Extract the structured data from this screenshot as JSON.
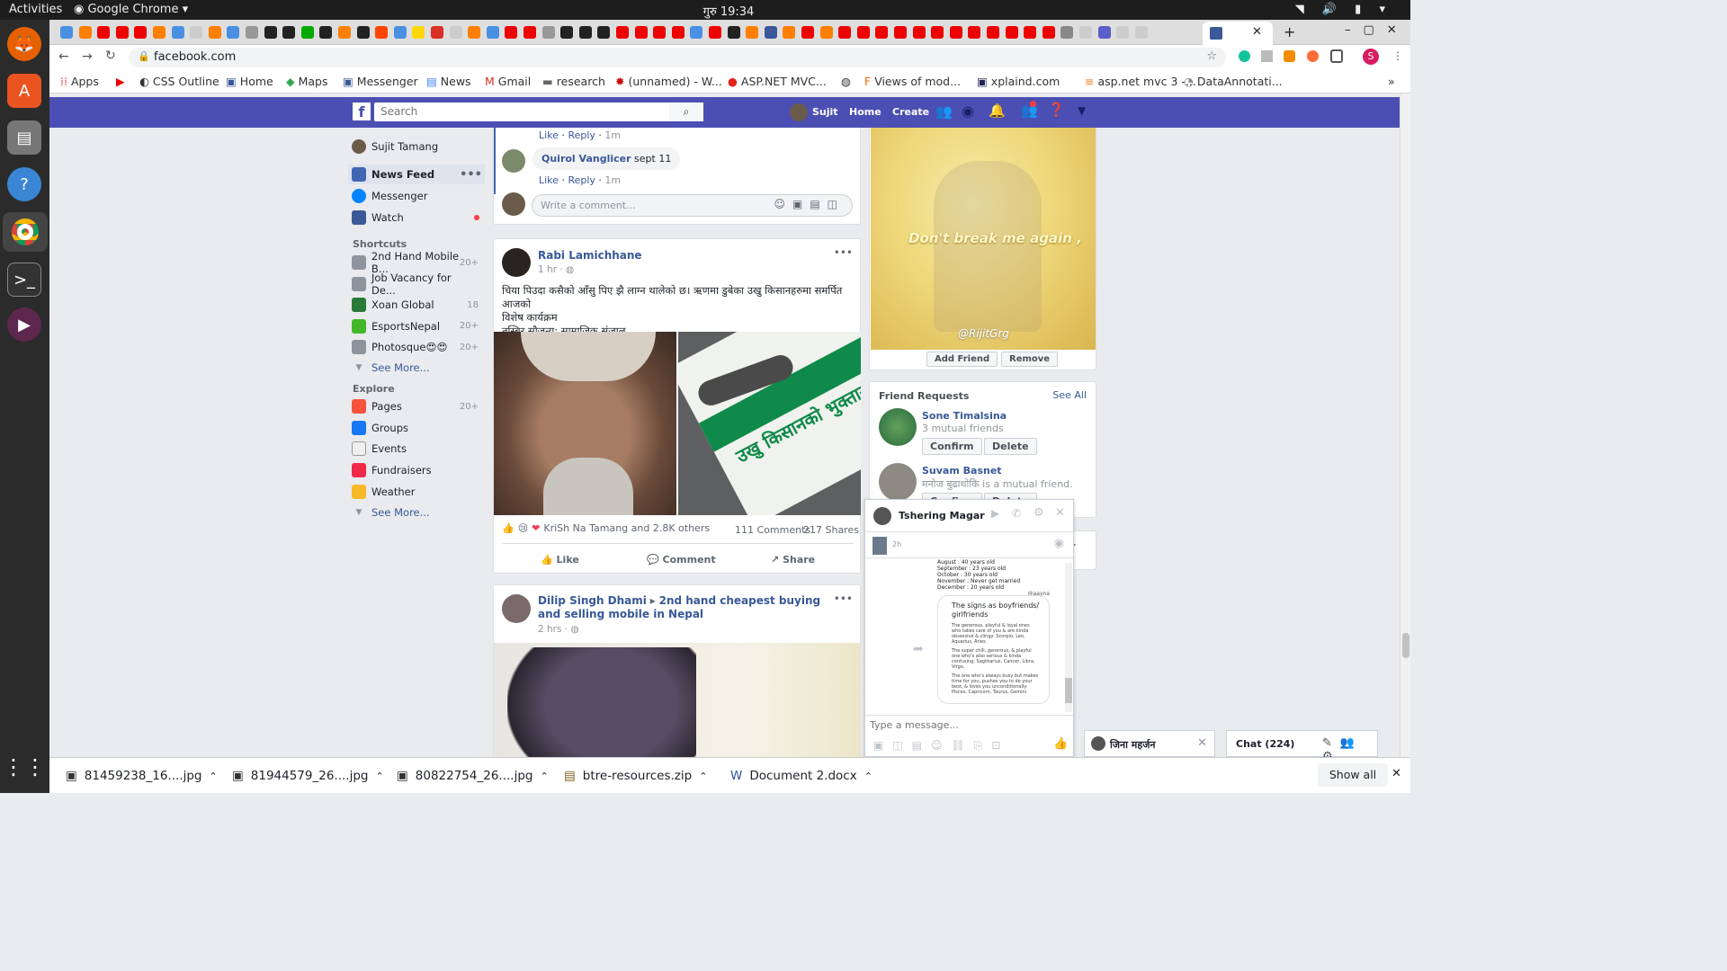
{
  "os": {
    "activities": "Activities",
    "app": "Google Chrome",
    "clock": "गुरु 19:34"
  },
  "browser": {
    "url": "facebook.com",
    "profile_initial": "S",
    "bookmarks": [
      "Apps",
      "CSS Outline",
      "Home",
      "Maps",
      "Messenger",
      "News",
      "Gmail",
      "research",
      "(unnamed) - W...",
      "ASP.NET MVC...",
      "Views of mod...",
      "xplaind.com",
      "asp.net mvc 3 -...",
      "DataAnnotati..."
    ]
  },
  "fb": {
    "search_placeholder": "Search",
    "user": "Sujit",
    "nav": [
      "Home",
      "Create"
    ],
    "sidebar": {
      "profile": "Sujit Tamang",
      "main": [
        {
          "label": "News Feed"
        },
        {
          "label": "Messenger"
        },
        {
          "label": "Watch"
        }
      ],
      "shortcuts_title": "Shortcuts",
      "shortcuts": [
        {
          "label": "2nd Hand Mobile B...",
          "count": "20+"
        },
        {
          "label": "Job Vacancy for De...",
          "count": ""
        },
        {
          "label": "Xoan Global",
          "count": "18"
        },
        {
          "label": "EsportsNepal",
          "count": "20+"
        },
        {
          "label": "Photosque😍😍",
          "count": "20+"
        }
      ],
      "see_more": "See More...",
      "explore_title": "Explore",
      "explore": [
        {
          "label": "Pages",
          "count": "20+"
        },
        {
          "label": "Groups",
          "count": ""
        },
        {
          "label": "Events",
          "count": ""
        },
        {
          "label": "Fundraisers",
          "count": ""
        },
        {
          "label": "Weather",
          "count": ""
        }
      ],
      "see_more2": "See More..."
    },
    "top_comment": {
      "like": "Like",
      "reply": "Reply",
      "time": "1m",
      "author": "Quirol Vanglicer",
      "text": "sept 11",
      "write": "Write a comment..."
    },
    "post1": {
      "author": "Rabi Lamichhane",
      "time": "1 hr",
      "text1": "चिया पिउदा कसैको आँसु पिए झै लाग्न थालेको छ। ऋणमा डुबेका उखु किसानहरुमा समर्पित आजको",
      "text2": "विशेष कार्यक्रम",
      "text3": "तस्बिर सौजन्य: सामाजिक संजाल",
      "reactions": "KriSh Na Tamang and 2.8K others",
      "comments": "111 Comments",
      "shares": "217 Shares",
      "banner_text": "उखु किसानको भुक्तानी",
      "actions": [
        "Like",
        "Comment",
        "Share"
      ]
    },
    "post2": {
      "author": "Dilip Singh Dhami",
      "group": "2nd hand cheapest buying and selling mobile in Nepal",
      "time": "2 hrs"
    },
    "right": {
      "video_caption": "Don't break me again ,",
      "video_credit": "@RijitGrg",
      "add_friend": "Add Friend",
      "remove": "Remove",
      "fr_title": "Friend Requests",
      "see_all": "See All",
      "requests": [
        {
          "name": "Sone Timalsina",
          "mutual": "3 mutual friends"
        },
        {
          "name": "Suvam Basnet",
          "mutual": "मनोज बुढाथोकि is a mutual friend."
        }
      ],
      "confirm": "Confirm",
      "delete": "Delete"
    },
    "chatwin": {
      "name": "Tshering Magar",
      "time": "2h",
      "placeholder": "Type a message...",
      "img_lines": [
        "August : 40 years old",
        "September : 23 years old",
        "October : 30 years old",
        "November : Never get married",
        "December : 20 years old"
      ],
      "img_handle": "@aayna",
      "img_title": "The signs as boyfriends/ girlfriends",
      "img_body": [
        "The generous, playful & loyal ones who takes care of you & are kinda obsessive & clingy: Scorpio, Leo, Aquarius, Aries.",
        "The super chill, generous, & playful one who's also serious & kinda confusing: Sagittarius, Cancer, Libra, Virgo.",
        "The one who's always busy but makes time for you, pushes you to do your best, & loves you unconditionally: Pisces, Capricorn, Taurus, Gemini"
      ]
    },
    "chatbar": {
      "tab": "जिना महर्जन",
      "label": "Chat (224)"
    }
  },
  "downloads": {
    "items": [
      "81459238_16....jpg",
      "81944579_26....jpg",
      "80822754_26....jpg",
      "btre-resources.zip",
      "Document 2.docx"
    ],
    "show_all": "Show all"
  }
}
